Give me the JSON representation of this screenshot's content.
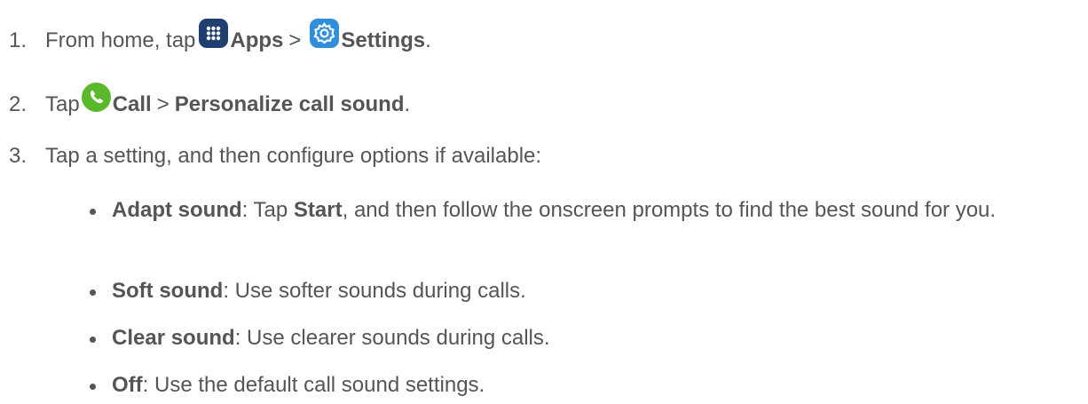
{
  "steps": [
    {
      "number": "1.",
      "lead": "From home, tap",
      "apps_label": "Apps",
      "sep": ">",
      "settings_label": "Settings",
      "end": ".",
      "icons": [
        "apps-icon",
        "settings-icon"
      ]
    },
    {
      "number": "2.",
      "lead": "Tap",
      "call_label": "Call",
      "sep": ">",
      "personalize_label": "Personalize call sound",
      "end": ".",
      "icons": [
        "phone-icon"
      ]
    },
    {
      "number": "3.",
      "text": "Tap a setting, and then configure options if available:"
    }
  ],
  "options": [
    {
      "term": "Adapt sound",
      "sep": ": Tap ",
      "term2": "Start",
      "rest": ", and then follow the onscreen prompts to find the best sound for you."
    },
    {
      "term": "Soft sound",
      "rest": ": Use softer sounds during calls."
    },
    {
      "term": "Clear sound",
      "rest": ": Use clearer sounds during calls."
    },
    {
      "term": "Off",
      "rest": ": Use the default call sound settings."
    }
  ],
  "colors": {
    "text": "#555555",
    "apps_icon_bg": "#1e3f6f",
    "settings_icon_bg": "#2f8fdc",
    "phone_icon_bg": "#5ab82b"
  }
}
